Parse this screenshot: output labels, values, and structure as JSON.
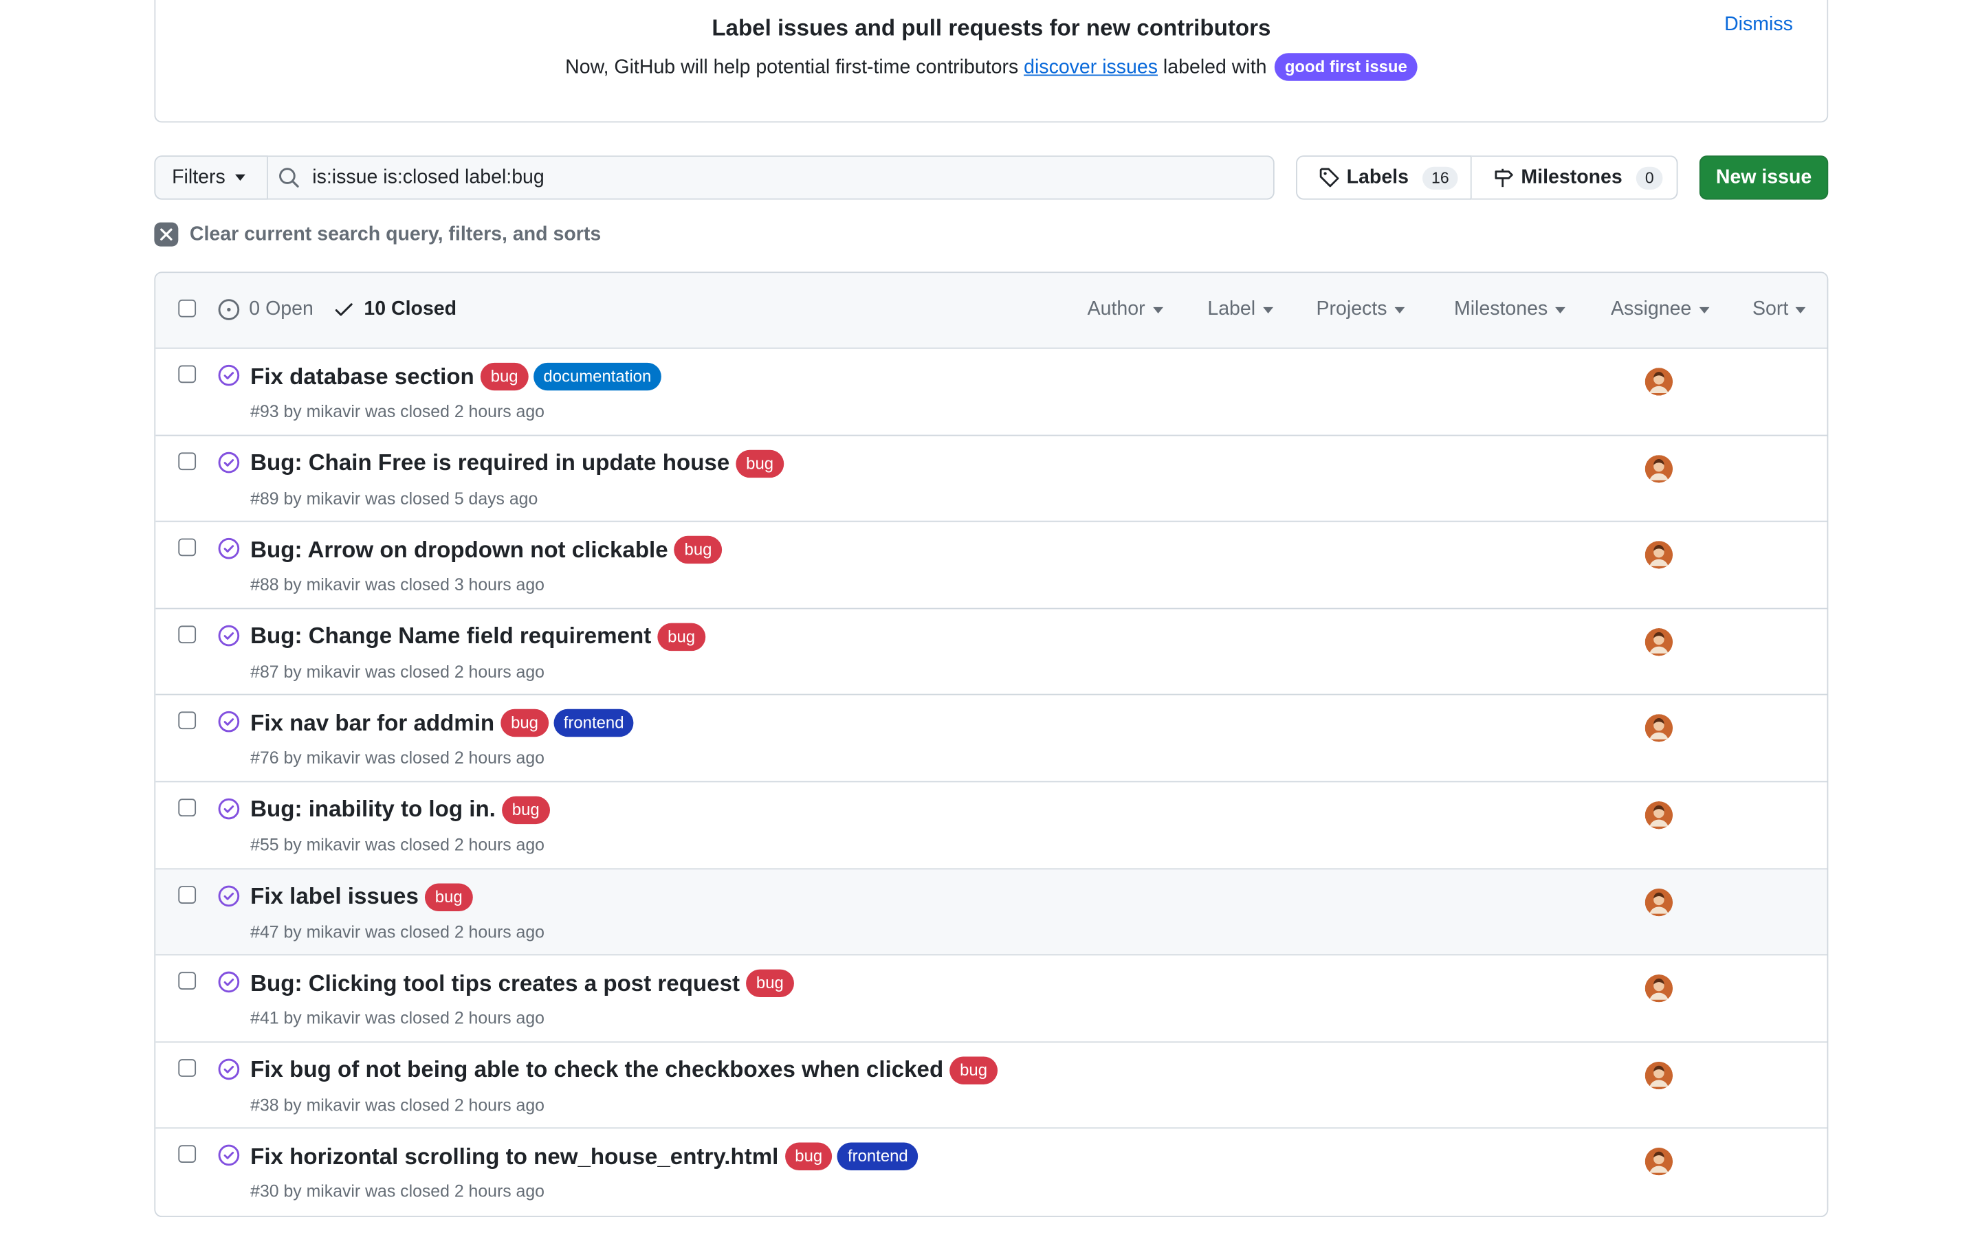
{
  "banner": {
    "title": "Label issues and pull requests for new contributors",
    "text_before_link": "Now, GitHub will help potential first-time contributors ",
    "link_text": "discover issues",
    "text_after_link": " labeled with",
    "label_text": "good first issue",
    "label_color": "#7057ff",
    "dismiss_label": "Dismiss"
  },
  "filters": {
    "button_label": "Filters",
    "search_value": "is:issue is:closed label:bug",
    "labels_label": "Labels",
    "labels_count": "16",
    "milestones_label": "Milestones",
    "milestones_count": "0",
    "new_issue_label": "New issue",
    "new_issue_color": "#1f883d"
  },
  "clear_filters_label": "Clear current search query, filters, and sorts",
  "list_header": {
    "open_label": "0 Open",
    "closed_label": "10 Closed",
    "menus": [
      "Author",
      "Label",
      "Projects",
      "Milestones",
      "Assignee",
      "Sort"
    ]
  },
  "label_colors": {
    "bug": "#d73a4a",
    "documentation": "#0075ca",
    "frontend": "#1d3bb8"
  },
  "issues": [
    {
      "title": "Fix database section",
      "labels": [
        "bug",
        "documentation"
      ],
      "meta": "#93 by mikavir was closed 2 hours ago"
    },
    {
      "title": "Bug: Chain Free is required in update house",
      "labels": [
        "bug"
      ],
      "meta": "#89 by mikavir was closed 5 days ago"
    },
    {
      "title": "Bug: Arrow on dropdown not clickable",
      "labels": [
        "bug"
      ],
      "meta": "#88 by mikavir was closed 3 hours ago"
    },
    {
      "title": "Bug: Change Name field requirement",
      "labels": [
        "bug"
      ],
      "meta": "#87 by mikavir was closed 2 hours ago"
    },
    {
      "title": "Fix nav bar for addmin",
      "labels": [
        "bug",
        "frontend"
      ],
      "meta": "#76 by mikavir was closed 2 hours ago"
    },
    {
      "title": "Bug: inability to log in.",
      "labels": [
        "bug"
      ],
      "meta": "#55 by mikavir was closed 2 hours ago"
    },
    {
      "title": "Fix label issues",
      "labels": [
        "bug"
      ],
      "meta": "#47 by mikavir was closed 2 hours ago"
    },
    {
      "title": "Bug: Clicking tool tips creates a post request",
      "labels": [
        "bug"
      ],
      "meta": "#41 by mikavir was closed 2 hours ago"
    },
    {
      "title": "Fix bug of not being able to check the checkboxes when clicked",
      "labels": [
        "bug"
      ],
      "meta": "#38 by mikavir was closed 2 hours ago"
    },
    {
      "title": "Fix horizontal scrolling to new_house_entry.html",
      "labels": [
        "bug",
        "frontend"
      ],
      "meta": "#30 by mikavir was closed 2 hours ago"
    }
  ],
  "closed_icon_color": "#8250df"
}
